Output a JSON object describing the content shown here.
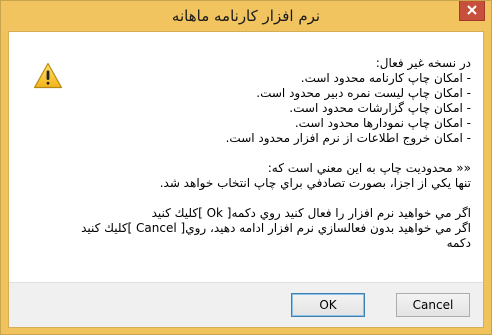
{
  "window": {
    "title": "نرم افزار كارنامه ماهانه"
  },
  "message": {
    "lines": [
      "در نسخه غير فعال:",
      "- امكان چاپ كارنامه محدود است.",
      "- امكان چاپ ليست نمره دبير محدود است.",
      "- امكان چاپ گزارشات محدود است.",
      "- امكان چاپ نمودارها محدود است.",
      "- امكان خروج اطلاعات از نرم افزار محدود است.",
      "",
      "«« محدوديت چاپ به اين معني است كه:",
      "تنها يكي از اجزا، بصورت تصادفي براي چاپ انتخاب خواهد شد.",
      "",
      "اگر مي خواهيد نرم افزار را فعال كنيد روي دكمه[ Ok ]كليك كنيد",
      "اگر مي خواهيد بدون فعالسازي نرم افزار ادامه دهيد، روي[ Cancel ]كليك كنيد",
      "دكمه"
    ]
  },
  "buttons": {
    "ok": "OK",
    "cancel": "Cancel"
  },
  "icons": {
    "warning": "warning-triangle-icon",
    "close": "close-icon"
  },
  "colors": {
    "titlebar": "#f1c460",
    "close_button": "#c7503d",
    "footer": "#f0f0f0"
  }
}
